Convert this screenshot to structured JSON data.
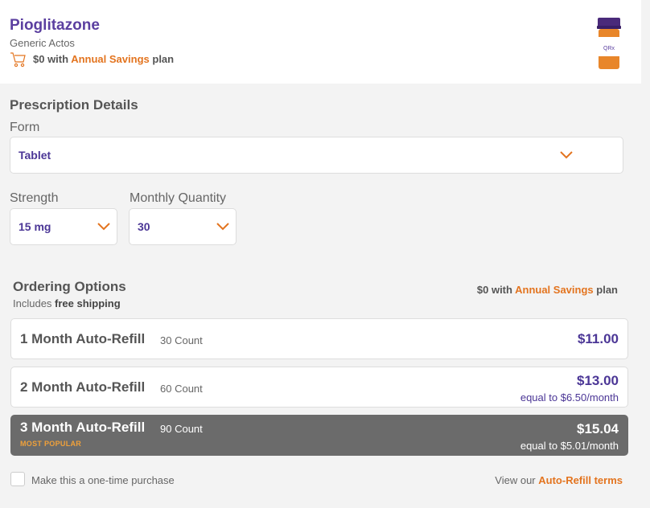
{
  "product": {
    "name": "Pioglitazone",
    "generic": "Generic Actos",
    "savings_prefix": "$0 with",
    "savings_plan": "Annual Savings",
    "savings_suffix": "plan",
    "bottle_label": "QRx"
  },
  "prescription": {
    "title": "Prescription Details",
    "form_label": "Form",
    "form_value": "Tablet",
    "strength_label": "Strength",
    "strength_value": "15 mg",
    "quantity_label": "Monthly Quantity",
    "quantity_value": "30"
  },
  "ordering": {
    "title": "Ordering Options",
    "sub_prefix": "Includes",
    "sub_bold": "free shipping",
    "savings_prefix": "$0 with",
    "savings_plan": "Annual Savings",
    "savings_suffix": "plan",
    "options": [
      {
        "name": "1 Month Auto-Refill",
        "count": "30 Count",
        "price": "$11.00",
        "equal": "",
        "badge": "",
        "selected": false
      },
      {
        "name": "2 Month Auto-Refill",
        "count": "60 Count",
        "price": "$13.00",
        "equal": "equal to $6.50/month",
        "badge": "",
        "selected": false
      },
      {
        "name": "3 Month Auto-Refill",
        "count": "90 Count",
        "price": "$15.04",
        "equal": "equal to $5.01/month",
        "badge": "MOST POPULAR",
        "selected": true
      }
    ]
  },
  "footer": {
    "one_time_label": "Make this a one-time purchase",
    "terms_prefix": "View our",
    "terms_link": "Auto-Refill terms"
  },
  "colors": {
    "brand_purple": "#5b3fa0",
    "accent_orange": "#e3741f",
    "selected_bg": "#6b6b6b",
    "badge_orange": "#f0a13a"
  },
  "icons": [
    "cart-icon",
    "chevron-down-icon",
    "pill-bottle-icon"
  ]
}
